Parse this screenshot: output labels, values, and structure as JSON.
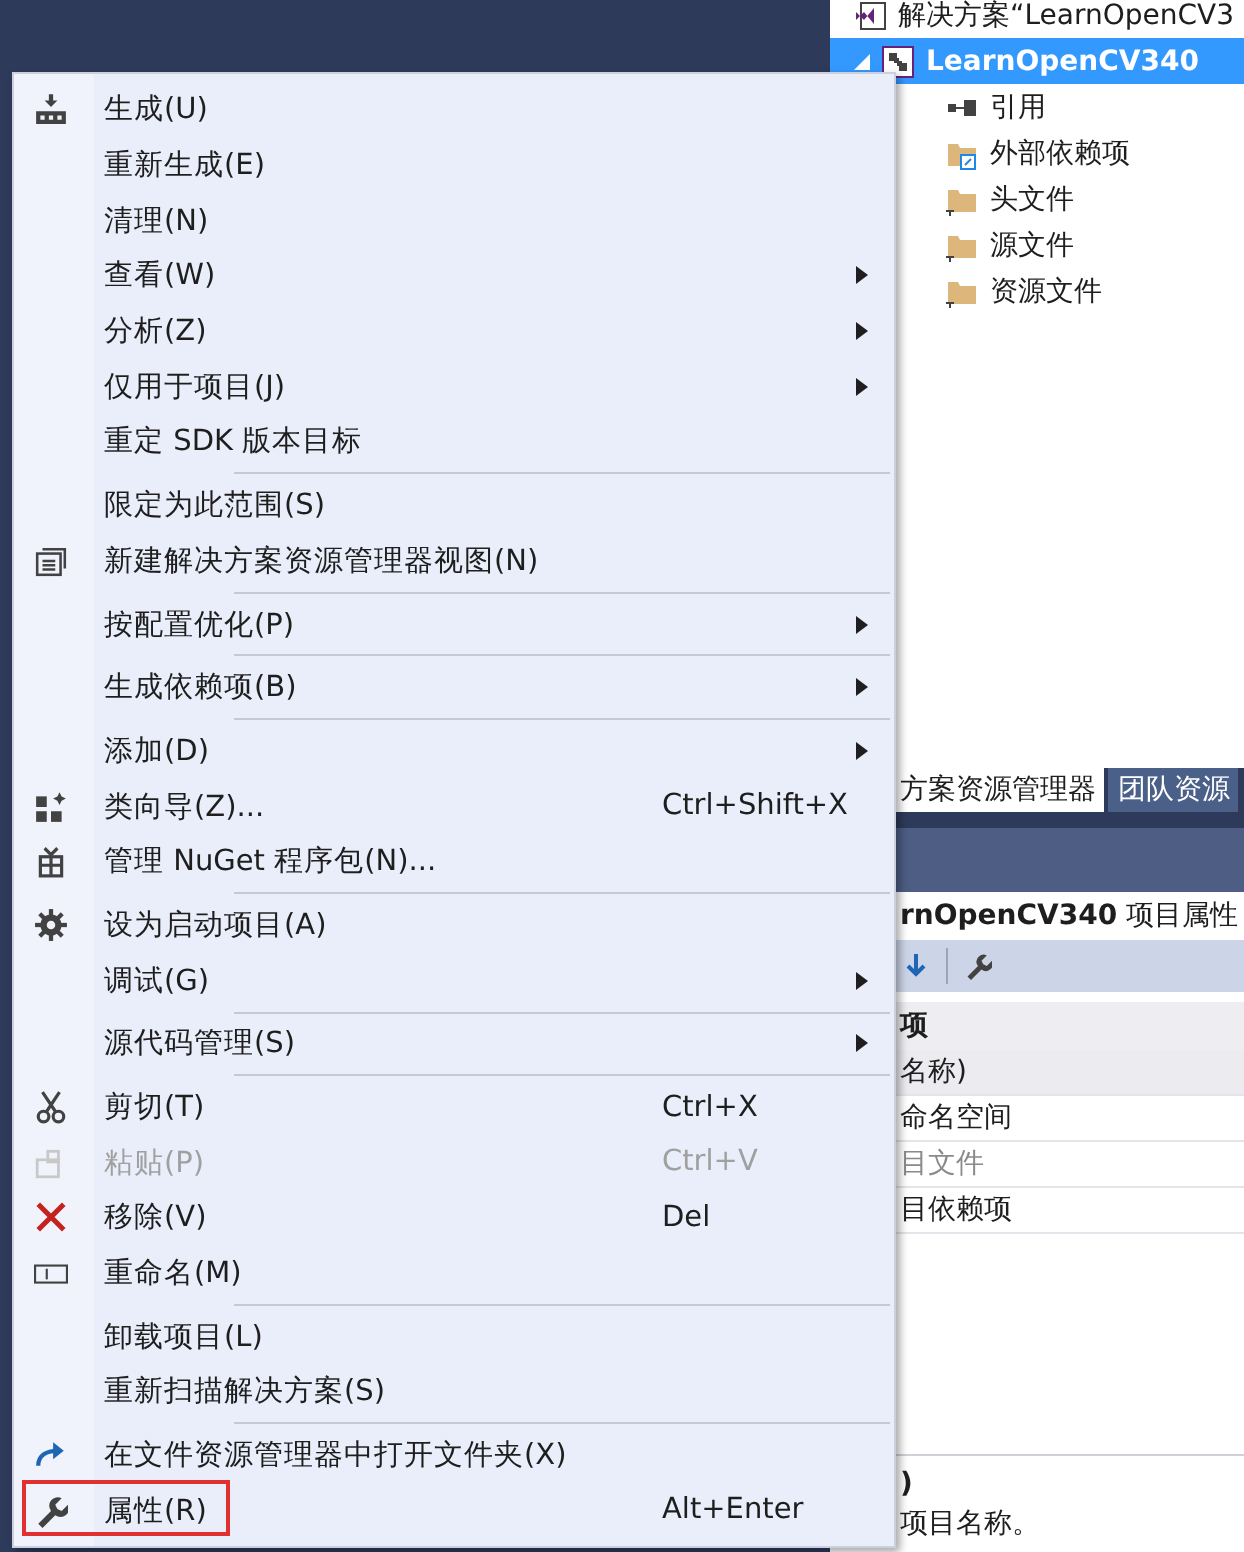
{
  "solution_explorer": {
    "solution_label": "解决方案“LearnOpenCV3",
    "project": {
      "label": "LearnOpenCV340",
      "selected": true,
      "expanded": true
    },
    "children": [
      {
        "label": "引用"
      },
      {
        "label": "外部依赖项"
      },
      {
        "label": "头文件"
      },
      {
        "label": "源文件"
      },
      {
        "label": "资源文件"
      }
    ]
  },
  "panel_tabs": [
    {
      "label": "方案资源管理器",
      "selected": true
    },
    {
      "label": "团队资源",
      "selected": false
    }
  ],
  "properties": {
    "title": "**rnOpenCV340** 项目属性",
    "category": "项",
    "rows": [
      {
        "label": "名称)",
        "selected": true,
        "disabled": false
      },
      {
        "label": "命名空间",
        "selected": false,
        "disabled": false
      },
      {
        "label": "目文件",
        "selected": false,
        "disabled": true
      },
      {
        "label": "目依赖项",
        "selected": false,
        "disabled": false
      }
    ],
    "description": {
      "title": ")",
      "text": "项目名称。"
    }
  },
  "context_menu": [
    {
      "kind": "item",
      "label": "生成(U)",
      "submenu": false,
      "disabled": false
    },
    {
      "kind": "item",
      "label": "重新生成(E)",
      "submenu": false,
      "disabled": false
    },
    {
      "kind": "item",
      "label": "清理(N)",
      "submenu": false,
      "disabled": false
    },
    {
      "kind": "item",
      "label": "查看(W)",
      "submenu": true,
      "disabled": false
    },
    {
      "kind": "item",
      "label": "分析(Z)",
      "submenu": true,
      "disabled": false
    },
    {
      "kind": "item",
      "label": "仅用于项目(J)",
      "submenu": true,
      "disabled": false
    },
    {
      "kind": "item",
      "label": "重定 SDK 版本目标",
      "submenu": false,
      "disabled": false
    },
    {
      "kind": "separator"
    },
    {
      "kind": "item",
      "label": "限定为此范围(S)",
      "submenu": false,
      "disabled": false
    },
    {
      "kind": "item",
      "label": "新建解决方案资源管理器视图(N)",
      "submenu": false,
      "disabled": false
    },
    {
      "kind": "separator"
    },
    {
      "kind": "item",
      "label": "按配置优化(P)",
      "submenu": true,
      "disabled": false
    },
    {
      "kind": "separator"
    },
    {
      "kind": "item",
      "label": "生成依赖项(B)",
      "submenu": true,
      "disabled": false
    },
    {
      "kind": "separator"
    },
    {
      "kind": "item",
      "label": "添加(D)",
      "submenu": true,
      "disabled": false
    },
    {
      "kind": "item",
      "label": "类向导(Z)...",
      "shortcut": "Ctrl+Shift+X",
      "submenu": false,
      "disabled": false
    },
    {
      "kind": "item",
      "label": "管理 NuGet 程序包(N)...",
      "submenu": false,
      "disabled": false
    },
    {
      "kind": "separator"
    },
    {
      "kind": "item",
      "label": "设为启动项目(A)",
      "submenu": false,
      "disabled": false
    },
    {
      "kind": "item",
      "label": "调试(G)",
      "submenu": true,
      "disabled": false
    },
    {
      "kind": "separator"
    },
    {
      "kind": "item",
      "label": "源代码管理(S)",
      "submenu": true,
      "disabled": false
    },
    {
      "kind": "separator"
    },
    {
      "kind": "item",
      "label": "剪切(T)",
      "shortcut": "Ctrl+X",
      "submenu": false,
      "disabled": false
    },
    {
      "kind": "item",
      "label": "粘贴(P)",
      "shortcut": "Ctrl+V",
      "submenu": false,
      "disabled": true
    },
    {
      "kind": "item",
      "label": "移除(V)",
      "shortcut": "Del",
      "submenu": false,
      "disabled": false
    },
    {
      "kind": "item",
      "label": "重命名(M)",
      "submenu": false,
      "disabled": false
    },
    {
      "kind": "separator"
    },
    {
      "kind": "item",
      "label": "卸载项目(L)",
      "submenu": false,
      "disabled": false
    },
    {
      "kind": "item",
      "label": "重新扫描解决方案(S)",
      "submenu": false,
      "disabled": false
    },
    {
      "kind": "separator"
    },
    {
      "kind": "item",
      "label": "在文件资源管理器中打开文件夹(X)",
      "submenu": false,
      "disabled": false
    },
    {
      "kind": "item",
      "label": "属性(R)",
      "shortcut": "Alt+Enter",
      "submenu": false,
      "disabled": false,
      "highlighted": true
    }
  ]
}
